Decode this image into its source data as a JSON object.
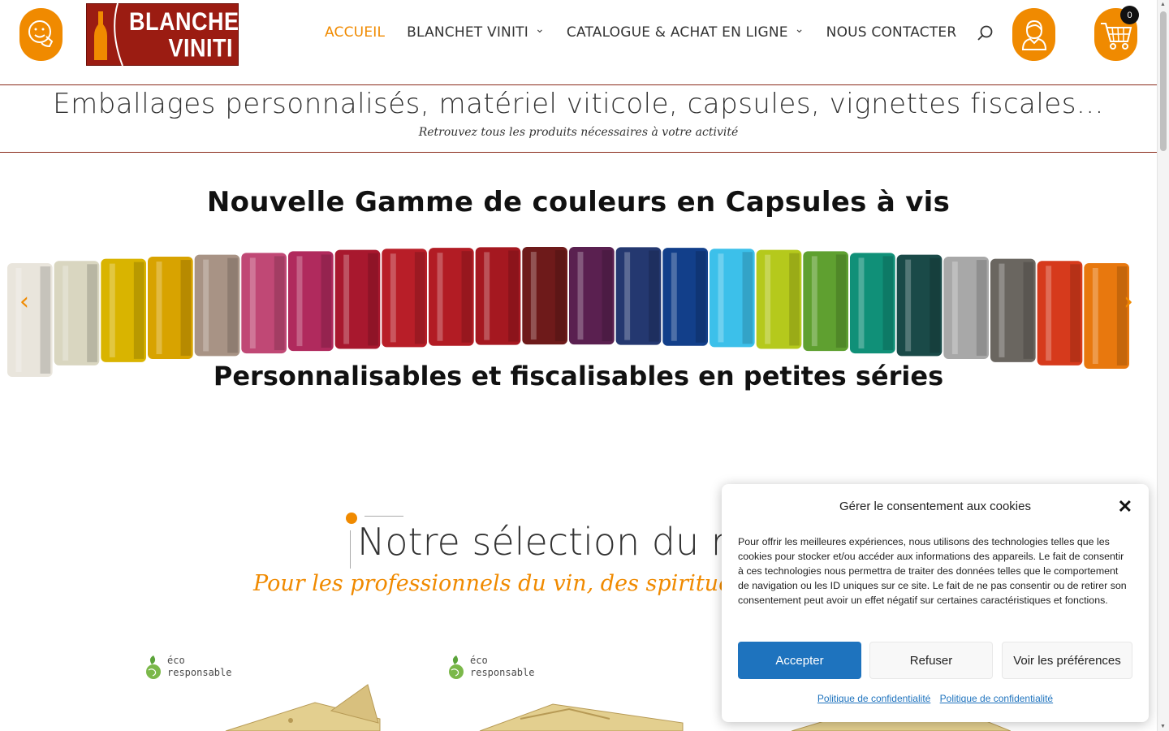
{
  "header": {
    "logo_line1": "BLANCHET",
    "logo_line2": "VINITI",
    "nav": [
      {
        "label": "ACCUEIL",
        "active": true,
        "dropdown": false
      },
      {
        "label": "BLANCHET VINITI",
        "active": false,
        "dropdown": true
      },
      {
        "label": "CATALOGUE & ACHAT EN LIGNE",
        "active": false,
        "dropdown": true
      },
      {
        "label": "NOUS CONTACTER",
        "active": false,
        "dropdown": false
      }
    ],
    "cart_count": "0"
  },
  "tagline": {
    "main": "Emballages personnalisés, matériel viticole, capsules, vignettes fiscales...",
    "sub": "Retrouvez tous les produits nécessaires à votre activité"
  },
  "hero": {
    "title": "Nouvelle Gamme de couleurs en Capsules à vis",
    "subtitle": "Personnalisables et fiscalisables en petites séries",
    "prev": "‹",
    "next": "›",
    "capsule_colors": [
      "#e9e5dc",
      "#d9d6c0",
      "#d9b400",
      "#d8a300",
      "#a89385",
      "#c04875",
      "#b02a5d",
      "#a8182e",
      "#b81e28",
      "#b21c24",
      "#a51820",
      "#6e1a1a",
      "#5a2050",
      "#243870",
      "#123f8a",
      "#3cc0ea",
      "#b5c91c",
      "#5fa030",
      "#109078",
      "#1a4a48",
      "#a8a8a8",
      "#6a6660",
      "#d63a1c",
      "#e8780e"
    ]
  },
  "selection": {
    "title": "Notre sélection du mo",
    "subtitle": "Pour les professionnels du vin, des spiritueux ou d"
  },
  "products": [
    {
      "eco_line1": "éco",
      "eco_line2": "responsable"
    },
    {
      "eco_line1": "éco",
      "eco_line2": "responsable"
    }
  ],
  "cookie": {
    "title": "Gérer le consentement aux cookies",
    "text": "Pour offrir les meilleures expériences, nous utilisons des technologies telles que les cookies pour stocker et/ou accéder aux informations des appareils. Le fait de consentir à ces technologies nous permettra de traiter des données telles que le comportement de navigation ou les ID uniques sur ce site. Le fait de ne pas consentir ou de retirer son consentement peut avoir un effet négatif sur certaines caractéristiques et fonctions.",
    "accept": "Accepter",
    "refuse": "Refuser",
    "preferences": "Voir les préférences",
    "link1": "Politique de confidentialité",
    "link2": "Politique de confidentialité"
  },
  "colors": {
    "accent": "#f08a00",
    "brand": "#9b1c12",
    "button": "#1e73be"
  }
}
